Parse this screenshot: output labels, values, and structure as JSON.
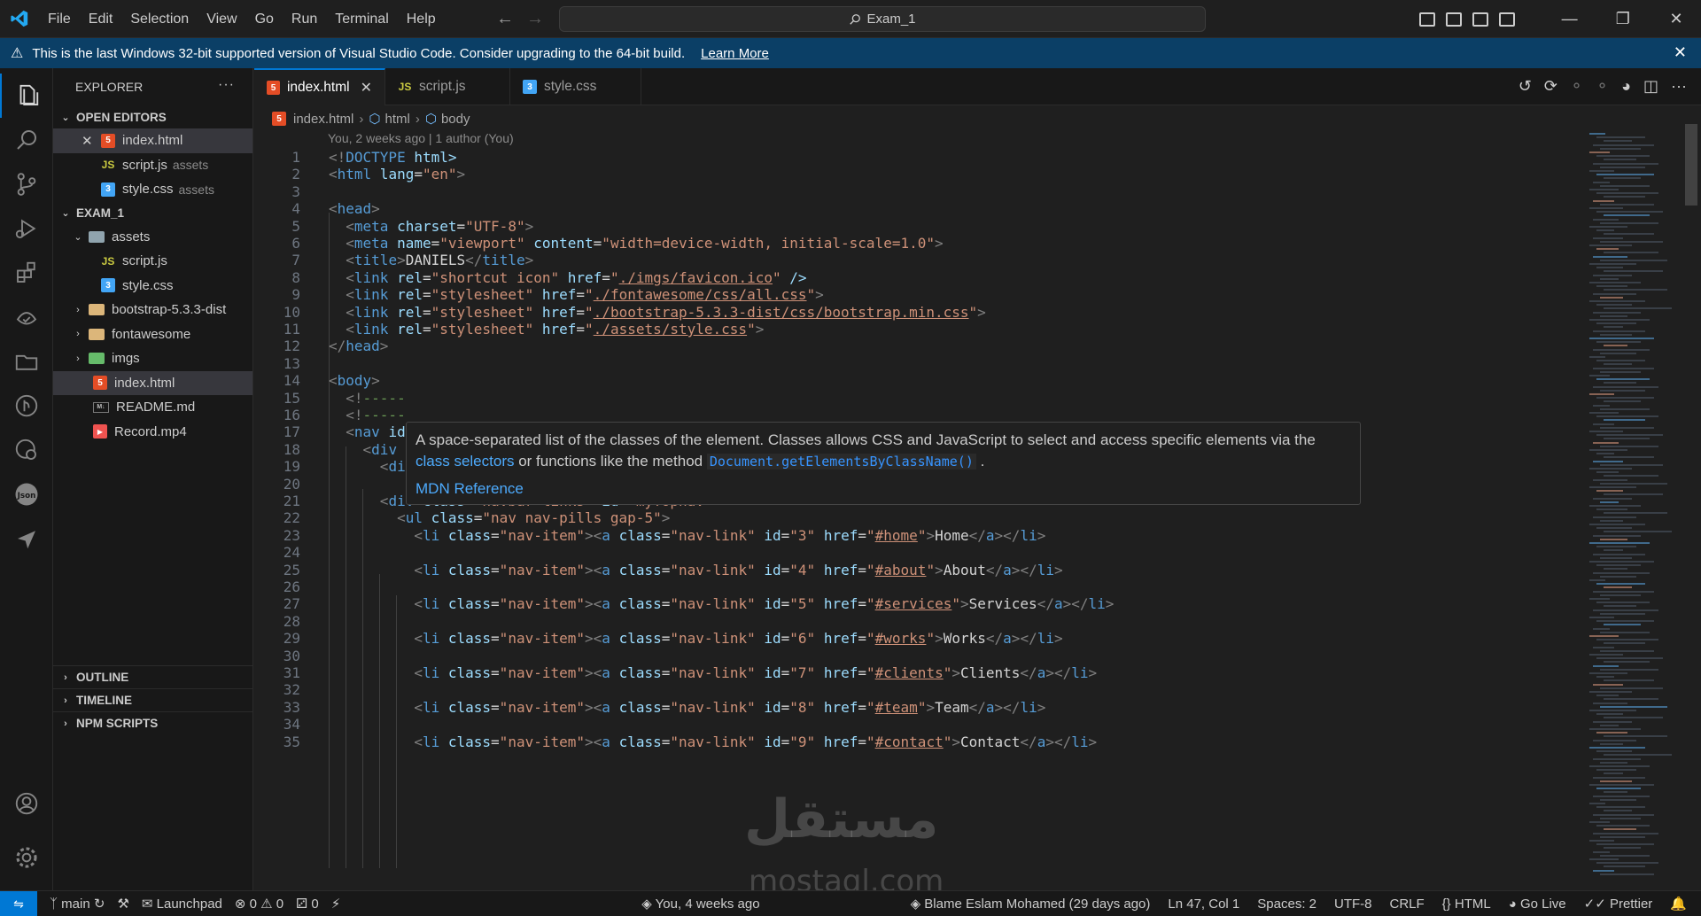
{
  "menu": [
    "File",
    "Edit",
    "Selection",
    "View",
    "Go",
    "Run",
    "Terminal",
    "Help"
  ],
  "search": {
    "label": "Exam_1"
  },
  "banner": {
    "message": "This is the last Windows 32-bit supported version of Visual Studio Code. Consider upgrading to the 64-bit build.",
    "link": "Learn More"
  },
  "sidebar": {
    "title": "EXPLORER",
    "open_editors_label": "OPEN EDITORS",
    "open_editors": [
      {
        "name": "index.html",
        "desc": ""
      },
      {
        "name": "script.js",
        "desc": "assets"
      },
      {
        "name": "style.css",
        "desc": "assets"
      }
    ],
    "project_label": "EXAM_1",
    "tree": [
      {
        "name": "assets"
      },
      {
        "name": "script.js"
      },
      {
        "name": "style.css"
      },
      {
        "name": "bootstrap-5.3.3-dist"
      },
      {
        "name": "fontawesome"
      },
      {
        "name": "imgs"
      },
      {
        "name": "index.html"
      },
      {
        "name": "README.md"
      },
      {
        "name": "Record.mp4"
      }
    ],
    "outline": "OUTLINE",
    "timeline": "TIMELINE",
    "npm_scripts": "NPM SCRIPTS"
  },
  "tabs": [
    {
      "label": "index.html"
    },
    {
      "label": "script.js"
    },
    {
      "label": "style.css"
    }
  ],
  "breadcrumb": [
    "index.html",
    "html",
    "body"
  ],
  "blame_header": "You, 2 weeks ago | 1 author (You)",
  "code_lines": [
    "<!DOCTYPE html>",
    "<html lang=\"en\">",
    "",
    "<head>",
    "  <meta charset=\"UTF-8\">",
    "  <meta name=\"viewport\" content=\"width=device-width, initial-scale=1.0\">",
    "  <title>DANIELS</title>",
    "  <link rel=\"shortcut icon\" href=\"./imgs/favicon.ico\" />",
    "  <link rel=\"stylesheet\" href=\"./fontawesome/css/all.css\">",
    "  <link rel=\"stylesheet\" href=\"./bootstrap-5.3.3-dist/css/bootstrap.min.css\">",
    "  <link rel=\"stylesheet\" href=\"./assets/style.css\">",
    "</head>",
    "",
    "<body>",
    "  <!-----",
    "  <!-----",
    "  <nav id",
    "    <div class=\"container\">",
    "      <div class=\"header\"><a class=\"navbar-brand\" id=\"1\" href=\"#\">daniels</a></div>",
    "",
    "      <div class=\"navbar-links\" id=\"myTopnav\">",
    "        <ul class=\"nav nav-pills gap-5\">",
    "          <li class=\"nav-item\"><a class=\"nav-link\" id=\"3\" href=\"#home\">Home</a></li>",
    "",
    "          <li class=\"nav-item\"><a class=\"nav-link\" id=\"4\" href=\"#about\">About</a></li>",
    "",
    "          <li class=\"nav-item\"><a class=\"nav-link\" id=\"5\" href=\"#services\">Services</a></li>",
    "",
    "          <li class=\"nav-item\"><a class=\"nav-link\" id=\"6\" href=\"#works\">Works</a></li>",
    "",
    "          <li class=\"nav-item\"><a class=\"nav-link\" id=\"7\" href=\"#clients\">Clients</a></li>",
    "",
    "          <li class=\"nav-item\"><a class=\"nav-link\" id=\"8\" href=\"#team\">Team</a></li>",
    "",
    "          <li class=\"nav-item\"><a class=\"nav-link\" id=\"9\" href=\"#contact\">Contact</a></li>"
  ],
  "hover": {
    "text_before": "A space-separated list of the classes of the element. Classes allows CSS and JavaScript to select and access specific elements via the ",
    "link1": "class selectors",
    "text_middle": " or functions like the method ",
    "code": "Document.getElementsByClassName()",
    "text_after": " .",
    "reference": "MDN Reference"
  },
  "status": {
    "branch": "main",
    "launchpad": "Launchpad",
    "problems": "0",
    "warnings": "0",
    "ports": "0",
    "blame_line": "You, 4 weeks ago",
    "blame_author": "Blame Eslam Mohamed (29 days ago)",
    "cursor": "Ln 47, Col 1",
    "spaces": "Spaces: 2",
    "encoding": "UTF-8",
    "eol": "CRLF",
    "language": "HTML",
    "golive": "Go Live",
    "prettier": "Prettier"
  },
  "watermark": {
    "line1": "مستقل",
    "line2": "mostaql.com"
  },
  "colors": {
    "accent": "#0078d4",
    "banner": "#0b3f66",
    "editor_bg": "#1f1f1f",
    "sidebar_bg": "#181818"
  }
}
